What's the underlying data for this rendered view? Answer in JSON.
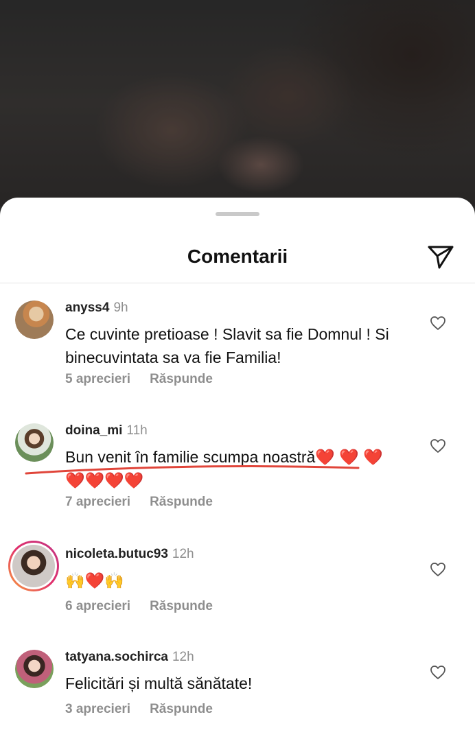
{
  "sheet": {
    "title": "Comentarii"
  },
  "comments": [
    {
      "username": "anyss4",
      "time": "9h",
      "text": "Ce cuvinte pretioase ! Slavit sa fie Domnul ! Si binecuvintata sa va fie Familia!",
      "likes": "5 aprecieri",
      "reply": "Răspunde",
      "avatar_color": "#b48a5a"
    },
    {
      "username": "doina_mi",
      "time": "11h",
      "text": "Bun venit în familie scumpa noastră❤️ ❤️ ❤️❤️❤️❤️❤️",
      "likes": "7 aprecieri",
      "reply": "Răspunde",
      "avatar_color": "#6b8f5a"
    },
    {
      "username": "nicoleta.butuc93",
      "time": "12h",
      "text": "🙌❤️🙌",
      "likes": "6 aprecieri",
      "reply": "Răspunde",
      "avatar_color": "#8a6a5c",
      "story_ring": true
    },
    {
      "username": "tatyana.sochirca",
      "time": "12h",
      "text": "Felicitări și multă sănătate!",
      "likes": "3 aprecieri",
      "reply": "Răspunde",
      "avatar_color": "#c0607a"
    }
  ],
  "icons": {
    "send": "send-icon",
    "like": "heart-outline-icon"
  },
  "colors": {
    "annotation_underline": "#e0453a",
    "secondary_text": "#8e8e8e"
  }
}
